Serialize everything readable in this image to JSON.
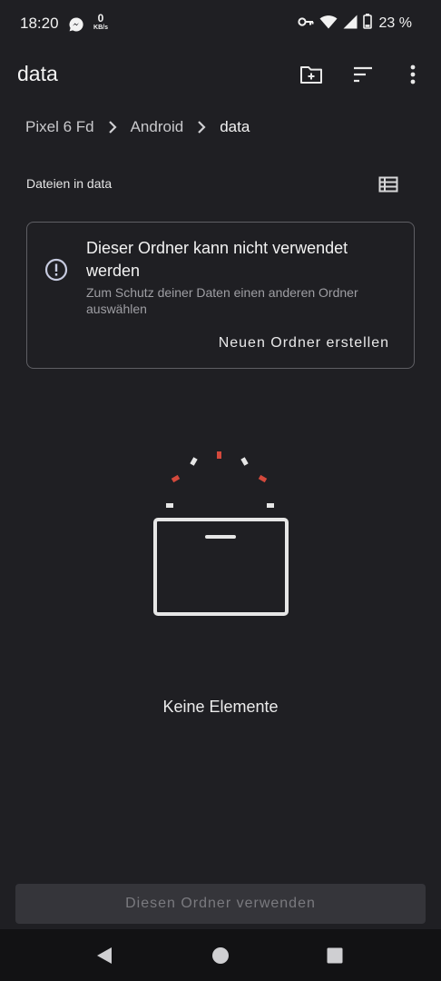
{
  "status_bar": {
    "time": "18:20",
    "net_speed_value": "0",
    "net_speed_unit": "KB/s",
    "battery_percent": "23 %",
    "icons": [
      "messenger-icon",
      "vpn-key-icon",
      "wifi-icon",
      "signal-icon",
      "battery-icon"
    ]
  },
  "toolbar": {
    "title": "data",
    "icons": [
      "new-folder-icon",
      "sort-icon",
      "more-vert-icon"
    ]
  },
  "breadcrumb": {
    "items": [
      "Pixel 6 Fd",
      "Android",
      "data"
    ]
  },
  "files_header": {
    "label": "Dateien in data",
    "view_icon": "list-view-icon"
  },
  "warning_card": {
    "title": "Dieser Ordner kann nicht verwendet werden",
    "subtitle": "Zum Schutz deiner Daten einen anderen Ordner auswählen",
    "action": "Neuen Ordner erstellen",
    "icon": "error-outline-icon"
  },
  "empty_state": {
    "text": "Keine Elemente",
    "illustration": "empty-box-illustration",
    "accent_color": "#d4493c"
  },
  "bottom_button": {
    "label": "Diesen Ordner verwenden",
    "enabled": false
  },
  "nav_bar": {
    "icons": [
      "back-icon",
      "home-icon",
      "recents-icon"
    ]
  }
}
